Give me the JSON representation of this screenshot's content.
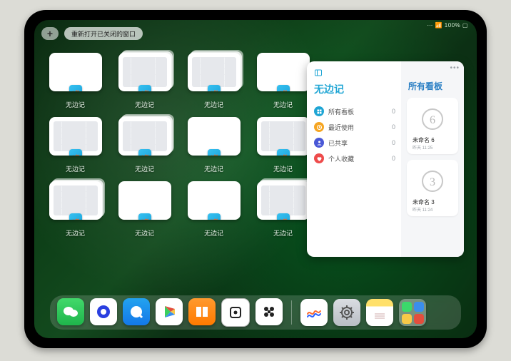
{
  "status": {
    "right": "⋯ 📶 100% ▢"
  },
  "toolbar": {
    "add_glyph": "+",
    "reopen_label": "重新打开已关闭的窗口"
  },
  "apps": {
    "name": "无边记",
    "tiles": [
      {
        "label": "无边记",
        "variant": "blank"
      },
      {
        "label": "无边记",
        "variant": "grid stack"
      },
      {
        "label": "无边记",
        "variant": "grid stack"
      },
      {
        "label": "无边记",
        "variant": "blank"
      },
      {
        "label": "无边记",
        "variant": "grid"
      },
      {
        "label": "无边记",
        "variant": "grid stack"
      },
      {
        "label": "无边记",
        "variant": "blank"
      },
      {
        "label": "无边记",
        "variant": "grid"
      },
      {
        "label": "无边记",
        "variant": "grid stack"
      },
      {
        "label": "无边记",
        "variant": "blank"
      },
      {
        "label": "无边记",
        "variant": "blank"
      },
      {
        "label": "无边记",
        "variant": "grid stack"
      }
    ]
  },
  "panel": {
    "left_title": "无边记",
    "right_title": "所有看板",
    "menu_dots": "•••",
    "items": [
      {
        "label": "所有看板",
        "count": "0",
        "color": "blue",
        "icon": "grid"
      },
      {
        "label": "最近使用",
        "count": "0",
        "color": "orng",
        "icon": "clock"
      },
      {
        "label": "已共享",
        "count": "0",
        "color": "prpl",
        "icon": "person"
      },
      {
        "label": "个人收藏",
        "count": "0",
        "color": "red",
        "icon": "heart"
      }
    ],
    "cards": [
      {
        "title": "未命名 6",
        "sub": "昨天 11:25",
        "digit": "6"
      },
      {
        "title": "未命名 3",
        "sub": "昨天 11:24",
        "digit": "3"
      }
    ]
  },
  "dock": {
    "apps": [
      "wechat",
      "qplay",
      "qq",
      "play",
      "books",
      "dice",
      "joy"
    ],
    "recent": [
      "free",
      "set",
      "notes",
      "library"
    ]
  }
}
